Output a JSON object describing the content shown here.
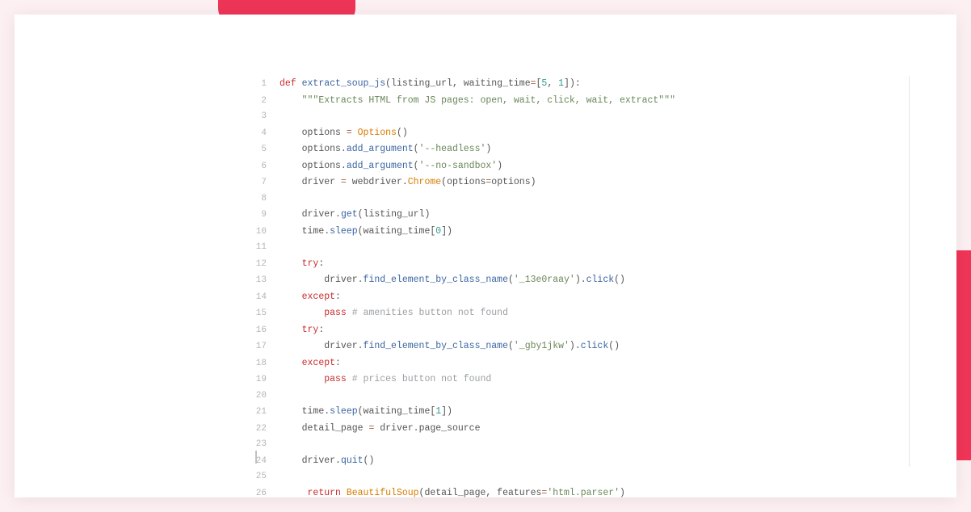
{
  "code": {
    "language": "python",
    "function_name": "extract_soup_js",
    "lines": [
      {
        "n": 1,
        "indent": 0,
        "tokens": [
          {
            "t": "def ",
            "c": "kw"
          },
          {
            "t": "extract_soup_js",
            "c": "fn"
          },
          {
            "t": "(",
            "c": "paren"
          },
          {
            "t": "listing_url",
            "c": "txt"
          },
          {
            "t": ",",
            "c": "txt"
          },
          {
            "t": " waiting_time",
            "c": "txt"
          },
          {
            "t": "=",
            "c": "op"
          },
          {
            "t": "[",
            "c": "paren"
          },
          {
            "t": "5",
            "c": "num"
          },
          {
            "t": ",",
            "c": "txt"
          },
          {
            "t": " ",
            "c": "txt"
          },
          {
            "t": "1",
            "c": "num"
          },
          {
            "t": "]",
            "c": "paren"
          },
          {
            "t": ")",
            "c": "paren"
          },
          {
            "t": ":",
            "c": "txt"
          }
        ]
      },
      {
        "n": 2,
        "indent": 1,
        "tokens": [
          {
            "t": "\"\"\"Extracts HTML from JS pages: open, wait, click, wait, extract\"\"\"",
            "c": "str"
          }
        ]
      },
      {
        "n": 3,
        "indent": 0,
        "tokens": []
      },
      {
        "n": 4,
        "indent": 1,
        "tokens": [
          {
            "t": "options ",
            "c": "txt"
          },
          {
            "t": "=",
            "c": "op"
          },
          {
            "t": " ",
            "c": "txt"
          },
          {
            "t": "Options",
            "c": "cls"
          },
          {
            "t": "()",
            "c": "paren"
          }
        ]
      },
      {
        "n": 5,
        "indent": 1,
        "tokens": [
          {
            "t": "options",
            "c": "txt"
          },
          {
            "t": ".",
            "c": "txt"
          },
          {
            "t": "add_argument",
            "c": "fn-call"
          },
          {
            "t": "(",
            "c": "paren"
          },
          {
            "t": "'--headless'",
            "c": "str"
          },
          {
            "t": ")",
            "c": "paren"
          }
        ]
      },
      {
        "n": 6,
        "indent": 1,
        "tokens": [
          {
            "t": "options",
            "c": "txt"
          },
          {
            "t": ".",
            "c": "txt"
          },
          {
            "t": "add_argument",
            "c": "fn-call"
          },
          {
            "t": "(",
            "c": "paren"
          },
          {
            "t": "'--no-sandbox'",
            "c": "str"
          },
          {
            "t": ")",
            "c": "paren"
          }
        ]
      },
      {
        "n": 7,
        "indent": 1,
        "tokens": [
          {
            "t": "driver ",
            "c": "txt"
          },
          {
            "t": "=",
            "c": "op"
          },
          {
            "t": " webdriver",
            "c": "txt"
          },
          {
            "t": ".",
            "c": "txt"
          },
          {
            "t": "Chrome",
            "c": "cls"
          },
          {
            "t": "(",
            "c": "paren"
          },
          {
            "t": "options",
            "c": "txt"
          },
          {
            "t": "=",
            "c": "op"
          },
          {
            "t": "options",
            "c": "txt"
          },
          {
            "t": ")",
            "c": "paren"
          }
        ]
      },
      {
        "n": 8,
        "indent": 0,
        "tokens": []
      },
      {
        "n": 9,
        "indent": 1,
        "tokens": [
          {
            "t": "driver",
            "c": "txt"
          },
          {
            "t": ".",
            "c": "txt"
          },
          {
            "t": "get",
            "c": "fn-call"
          },
          {
            "t": "(",
            "c": "paren"
          },
          {
            "t": "listing_url",
            "c": "txt"
          },
          {
            "t": ")",
            "c": "paren"
          }
        ]
      },
      {
        "n": 10,
        "indent": 1,
        "tokens": [
          {
            "t": "time",
            "c": "txt"
          },
          {
            "t": ".",
            "c": "txt"
          },
          {
            "t": "sleep",
            "c": "fn-call"
          },
          {
            "t": "(",
            "c": "paren"
          },
          {
            "t": "waiting_time",
            "c": "txt"
          },
          {
            "t": "[",
            "c": "paren"
          },
          {
            "t": "0",
            "c": "num"
          },
          {
            "t": "]",
            "c": "paren"
          },
          {
            "t": ")",
            "c": "paren"
          }
        ]
      },
      {
        "n": 11,
        "indent": 0,
        "tokens": []
      },
      {
        "n": 12,
        "indent": 1,
        "tokens": [
          {
            "t": "try",
            "c": "kw"
          },
          {
            "t": ":",
            "c": "txt"
          }
        ]
      },
      {
        "n": 13,
        "indent": 2,
        "tokens": [
          {
            "t": "driver",
            "c": "txt"
          },
          {
            "t": ".",
            "c": "txt"
          },
          {
            "t": "find_element_by_class_name",
            "c": "fn-call"
          },
          {
            "t": "(",
            "c": "paren"
          },
          {
            "t": "'_13e0raay'",
            "c": "str"
          },
          {
            "t": ")",
            "c": "paren"
          },
          {
            "t": ".",
            "c": "txt"
          },
          {
            "t": "click",
            "c": "fn-call"
          },
          {
            "t": "()",
            "c": "paren"
          }
        ]
      },
      {
        "n": 14,
        "indent": 1,
        "tokens": [
          {
            "t": "except",
            "c": "kw"
          },
          {
            "t": ":",
            "c": "txt"
          }
        ]
      },
      {
        "n": 15,
        "indent": 2,
        "tokens": [
          {
            "t": "pass",
            "c": "kw"
          },
          {
            "t": " ",
            "c": "txt"
          },
          {
            "t": "# amenities button not found",
            "c": "comment"
          }
        ]
      },
      {
        "n": 16,
        "indent": 1,
        "tokens": [
          {
            "t": "try",
            "c": "kw"
          },
          {
            "t": ":",
            "c": "txt"
          }
        ]
      },
      {
        "n": 17,
        "indent": 2,
        "tokens": [
          {
            "t": "driver",
            "c": "txt"
          },
          {
            "t": ".",
            "c": "txt"
          },
          {
            "t": "find_element_by_class_name",
            "c": "fn-call"
          },
          {
            "t": "(",
            "c": "paren"
          },
          {
            "t": "'_gby1jkw'",
            "c": "str"
          },
          {
            "t": ")",
            "c": "paren"
          },
          {
            "t": ".",
            "c": "txt"
          },
          {
            "t": "click",
            "c": "fn-call"
          },
          {
            "t": "()",
            "c": "paren"
          }
        ]
      },
      {
        "n": 18,
        "indent": 1,
        "tokens": [
          {
            "t": "except",
            "c": "kw"
          },
          {
            "t": ":",
            "c": "txt"
          }
        ]
      },
      {
        "n": 19,
        "indent": 2,
        "tokens": [
          {
            "t": "pass",
            "c": "kw"
          },
          {
            "t": " ",
            "c": "txt"
          },
          {
            "t": "# prices button not found",
            "c": "comment"
          }
        ]
      },
      {
        "n": 20,
        "indent": 0,
        "tokens": []
      },
      {
        "n": 21,
        "indent": 1,
        "tokens": [
          {
            "t": "time",
            "c": "txt"
          },
          {
            "t": ".",
            "c": "txt"
          },
          {
            "t": "sleep",
            "c": "fn-call"
          },
          {
            "t": "(",
            "c": "paren"
          },
          {
            "t": "waiting_time",
            "c": "txt"
          },
          {
            "t": "[",
            "c": "paren"
          },
          {
            "t": "1",
            "c": "num"
          },
          {
            "t": "]",
            "c": "paren"
          },
          {
            "t": ")",
            "c": "paren"
          }
        ]
      },
      {
        "n": 22,
        "indent": 1,
        "tokens": [
          {
            "t": "detail_page ",
            "c": "txt"
          },
          {
            "t": "=",
            "c": "op"
          },
          {
            "t": " driver",
            "c": "txt"
          },
          {
            "t": ".",
            "c": "txt"
          },
          {
            "t": "page_source",
            "c": "txt"
          }
        ]
      },
      {
        "n": 23,
        "indent": 0,
        "tokens": []
      },
      {
        "n": 24,
        "indent": 1,
        "tokens": [
          {
            "t": "driver",
            "c": "txt"
          },
          {
            "t": ".",
            "c": "txt"
          },
          {
            "t": "quit",
            "c": "fn-call"
          },
          {
            "t": "()",
            "c": "paren"
          }
        ]
      },
      {
        "n": 25,
        "indent": 0,
        "tokens": []
      },
      {
        "n": 26,
        "indent": 1,
        "extra_prefix": " ",
        "tokens": [
          {
            "t": "return ",
            "c": "kw"
          },
          {
            "t": "BeautifulSoup",
            "c": "cls"
          },
          {
            "t": "(",
            "c": "paren"
          },
          {
            "t": "detail_page",
            "c": "txt"
          },
          {
            "t": ",",
            "c": "txt"
          },
          {
            "t": " features",
            "c": "txt"
          },
          {
            "t": "=",
            "c": "op"
          },
          {
            "t": "'html.parser'",
            "c": "str"
          },
          {
            "t": ")",
            "c": "paren"
          }
        ]
      }
    ]
  },
  "indent_unit": "    "
}
